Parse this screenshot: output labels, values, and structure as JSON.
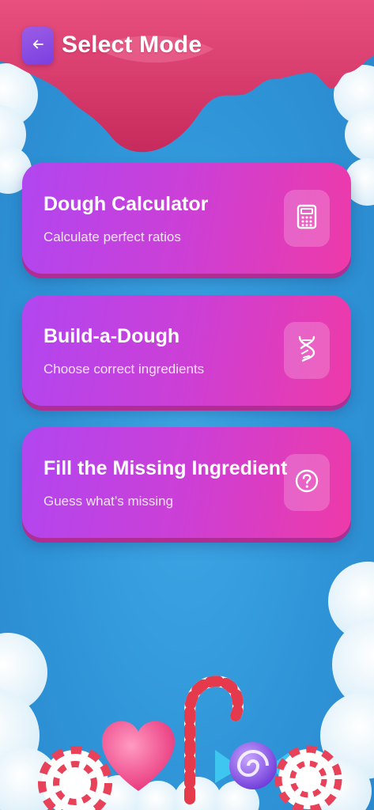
{
  "header": {
    "title": "Select Mode",
    "back_icon": "arrow-left-icon"
  },
  "modes": [
    {
      "title": "Dough Calculator",
      "subtitle": "Calculate perfect ratios",
      "icon": "calculator-icon"
    },
    {
      "title": "Build-a-Dough",
      "subtitle": "Choose correct ingredients",
      "icon": "dna-icon"
    },
    {
      "title": "Fill the Missing Ingredient",
      "subtitle": "Guess what’s missing",
      "icon": "question-circle-icon"
    }
  ],
  "colors": {
    "background": "#2f95d8",
    "drip": "#d93a70",
    "card_start": "#b146f0",
    "card_end": "#ee3aa8",
    "back_button": "#8b4fe3"
  }
}
